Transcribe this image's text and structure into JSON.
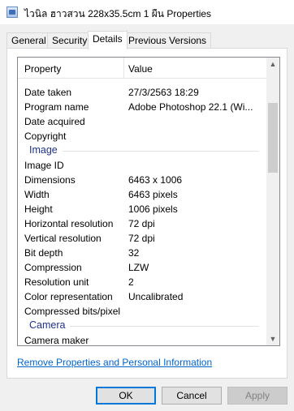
{
  "window": {
    "title": "ไวนิล ฮาวสวน 228x35.5cm 1 ผืน Properties"
  },
  "tabs": [
    {
      "label": "General",
      "active": false
    },
    {
      "label": "Security",
      "active": false
    },
    {
      "label": "Details",
      "active": true
    },
    {
      "label": "Previous Versions",
      "active": false
    }
  ],
  "list": {
    "header": {
      "property": "Property",
      "value": "Value"
    },
    "rows": [
      {
        "type": "item",
        "property": "Date taken",
        "value": "27/3/2563 18:29"
      },
      {
        "type": "item",
        "property": "Program name",
        "value": "Adobe Photoshop 22.1 (Wi..."
      },
      {
        "type": "item",
        "property": "Date acquired",
        "value": ""
      },
      {
        "type": "item",
        "property": "Copyright",
        "value": ""
      },
      {
        "type": "group",
        "property": "Image",
        "value": ""
      },
      {
        "type": "item",
        "property": "Image ID",
        "value": ""
      },
      {
        "type": "item",
        "property": "Dimensions",
        "value": "6463 x 1006"
      },
      {
        "type": "item",
        "property": "Width",
        "value": "6463 pixels"
      },
      {
        "type": "item",
        "property": "Height",
        "value": "1006 pixels"
      },
      {
        "type": "item",
        "property": "Horizontal resolution",
        "value": "72 dpi"
      },
      {
        "type": "item",
        "property": "Vertical resolution",
        "value": "72 dpi"
      },
      {
        "type": "item",
        "property": "Bit depth",
        "value": "32"
      },
      {
        "type": "item",
        "property": "Compression",
        "value": "LZW"
      },
      {
        "type": "item",
        "property": "Resolution unit",
        "value": "2"
      },
      {
        "type": "item",
        "property": "Color representation",
        "value": "Uncalibrated"
      },
      {
        "type": "item",
        "property": "Compressed bits/pixel",
        "value": ""
      },
      {
        "type": "group",
        "property": "Camera",
        "value": ""
      },
      {
        "type": "item",
        "property": "Camera maker",
        "value": ""
      }
    ]
  },
  "link": {
    "label": "Remove Properties and Personal Information"
  },
  "buttons": {
    "ok": "OK",
    "cancel": "Cancel",
    "apply": "Apply"
  },
  "colors": {
    "group_label": "#1e3287",
    "link": "#0066cc",
    "focus": "#0078d7"
  }
}
